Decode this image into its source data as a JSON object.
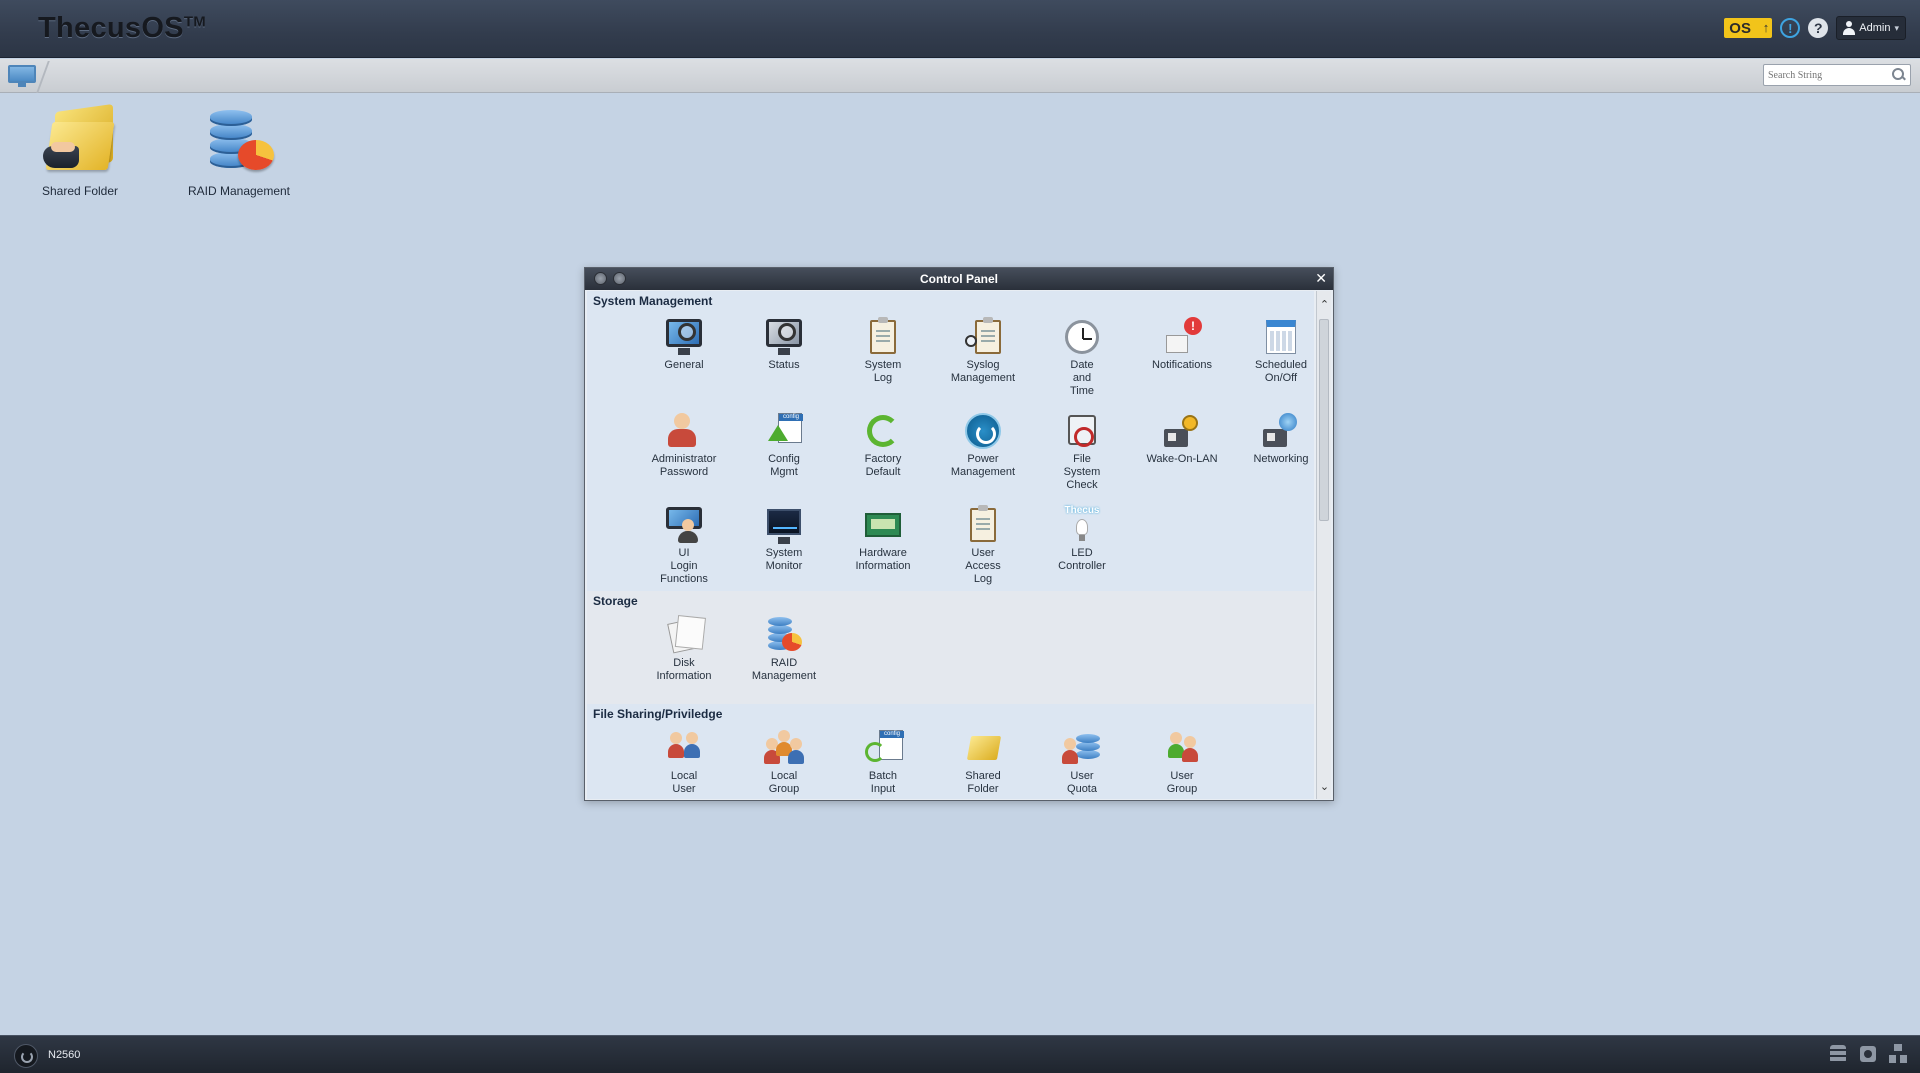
{
  "header": {
    "brand": "ThecusOS",
    "brand_tm": "TM",
    "os_badge": "OS",
    "admin_label": "Admin",
    "icons": [
      "os-update-icon",
      "info-icon",
      "help-icon",
      "user-icon"
    ]
  },
  "toolbar": {
    "search_placeholder": "Search String"
  },
  "desktop": {
    "icons": [
      {
        "label": "Shared Folder",
        "icon": "shared-folder-icon"
      },
      {
        "label": "RAID Management",
        "icon": "raid-management-icon"
      }
    ]
  },
  "control_panel": {
    "title": "Control Panel",
    "sections": [
      {
        "title": "System Management",
        "items": [
          {
            "label": "General",
            "icon": "general-icon"
          },
          {
            "label": "Status",
            "icon": "status-icon"
          },
          {
            "label": "System\nLog",
            "icon": "system-log-icon"
          },
          {
            "label": "Syslog\nManagement",
            "icon": "syslog-management-icon"
          },
          {
            "label": "Date\nand\nTime",
            "icon": "date-time-icon"
          },
          {
            "label": "Notifications",
            "icon": "notifications-icon"
          },
          {
            "label": "Scheduled\nOn/Off",
            "icon": "scheduled-onoff-icon"
          },
          {
            "label": "Administrator\nPassword",
            "icon": "administrator-password-icon"
          },
          {
            "label": "Config\nMgmt",
            "icon": "config-mgmt-icon"
          },
          {
            "label": "Factory\nDefault",
            "icon": "factory-default-icon"
          },
          {
            "label": "Power\nManagement",
            "icon": "power-management-icon"
          },
          {
            "label": "File\nSystem\nCheck",
            "icon": "file-system-check-icon"
          },
          {
            "label": "Wake-On-LAN",
            "icon": "wake-on-lan-icon"
          },
          {
            "label": "Networking",
            "icon": "networking-icon"
          },
          {
            "label": "UI\nLogin\nFunctions",
            "icon": "ui-login-functions-icon"
          },
          {
            "label": "System\nMonitor",
            "icon": "system-monitor-icon"
          },
          {
            "label": "Hardware\nInformation",
            "icon": "hardware-information-icon"
          },
          {
            "label": "User\nAccess\nLog",
            "icon": "user-access-log-icon"
          },
          {
            "label": "LED\nController",
            "icon": "led-controller-icon",
            "logo_text": "Thecus"
          }
        ]
      },
      {
        "title": "Storage",
        "items": [
          {
            "label": "Disk\nInformation",
            "icon": "disk-information-icon"
          },
          {
            "label": "RAID\nManagement",
            "icon": "raid-management-icon"
          }
        ]
      },
      {
        "title": "File Sharing/Priviledge",
        "items": [
          {
            "label": "Local\nUser",
            "icon": "local-user-icon"
          },
          {
            "label": "Local\nGroup",
            "icon": "local-group-icon"
          },
          {
            "label": "Batch\nInput",
            "icon": "batch-input-icon"
          },
          {
            "label": "Shared\nFolder",
            "icon": "shared-folder-icon"
          },
          {
            "label": "User\nQuota",
            "icon": "user-quota-icon"
          },
          {
            "label": "User\nGroup",
            "icon": "user-group-icon"
          }
        ]
      }
    ]
  },
  "taskbar": {
    "model": "N2560",
    "tray_icons": [
      "database-icon",
      "disk-icon",
      "network-icon"
    ]
  },
  "colors": {
    "desktop_bg": "#c5d3e4",
    "header_bg": "#353f50",
    "os_badge": "#f2c41a",
    "info_blue": "#3ea3e0"
  }
}
